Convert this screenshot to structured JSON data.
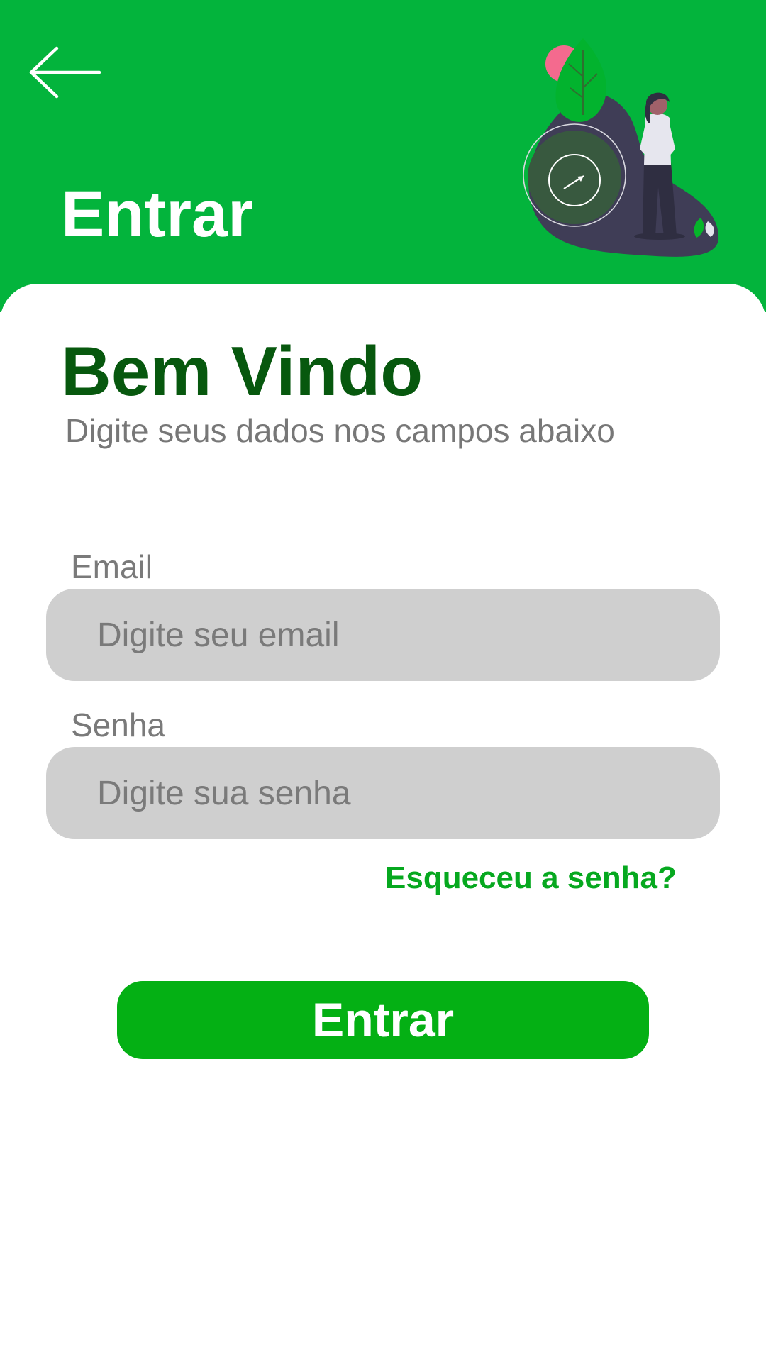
{
  "header": {
    "back_icon": "arrow-left-icon",
    "title": "Entrar",
    "background_color": "#03b43c"
  },
  "card": {
    "welcome_title": "Bem Vindo",
    "subtitle": "Digite seus dados nos campos abaixo"
  },
  "form": {
    "email": {
      "label": "Email",
      "placeholder": "Digite seu email",
      "value": ""
    },
    "password": {
      "label": "Senha",
      "placeholder": "Digite sua senha",
      "value": ""
    },
    "forgot_link": "Esqueceu a senha?",
    "submit_label": "Entrar"
  },
  "colors": {
    "brand_green": "#03b43c",
    "title_green": "#07580e",
    "button_green": "#04b014",
    "field_gray": "#cfcfcf"
  }
}
